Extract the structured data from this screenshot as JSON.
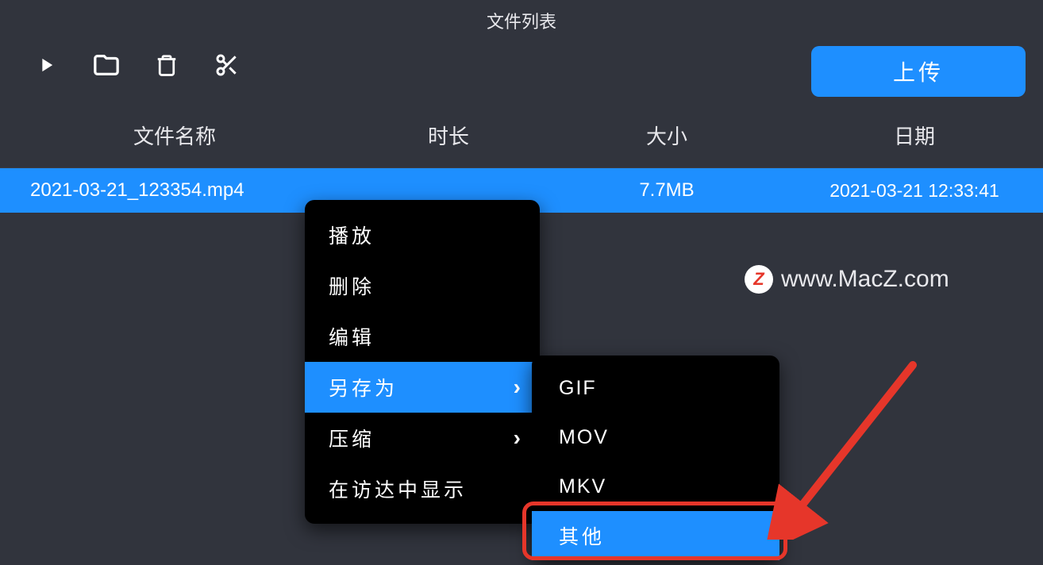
{
  "title": "文件列表",
  "toolbar": {
    "upload_label": "上传"
  },
  "columns": {
    "name": "文件名称",
    "duration": "时长",
    "size": "大小",
    "date": "日期"
  },
  "row": {
    "name": "2021-03-21_123354.mp4",
    "size": "7.7MB",
    "date": "2021-03-21 12:33:41"
  },
  "context_menu": {
    "play": "播放",
    "delete": "删除",
    "edit": "编辑",
    "save_as": "另存为",
    "compress": "压缩",
    "show_in_finder": "在访达中显示"
  },
  "save_as_menu": {
    "gif": "GIF",
    "mov": "MOV",
    "mkv": "MKV",
    "other": "其他"
  },
  "watermark": {
    "badge": "Z",
    "text": "www.MacZ.com"
  }
}
